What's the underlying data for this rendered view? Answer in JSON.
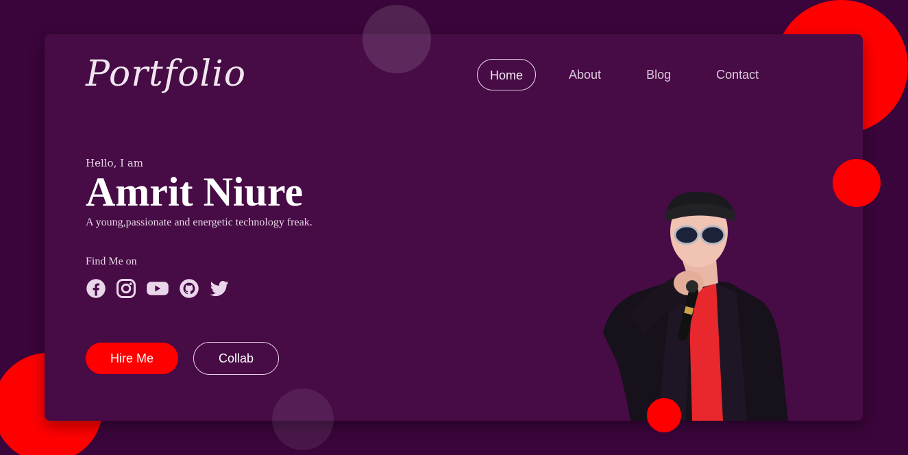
{
  "logo": {
    "text": "Portfolio"
  },
  "nav": {
    "items": [
      {
        "label": "Home",
        "active": true
      },
      {
        "label": "About",
        "active": false
      },
      {
        "label": "Blog",
        "active": false
      },
      {
        "label": "Contact",
        "active": false
      }
    ]
  },
  "hero": {
    "greeting": "Hello, I am",
    "name": "Amrit Niure",
    "tagline": "A young,passionate and energetic technology freak.",
    "find_label": "Find Me on",
    "socials": [
      {
        "icon": "facebook-icon"
      },
      {
        "icon": "instagram-icon"
      },
      {
        "icon": "youtube-icon"
      },
      {
        "icon": "github-icon"
      },
      {
        "icon": "twitter-icon"
      }
    ],
    "hire_label": "Hire Me",
    "collab_label": "Collab"
  },
  "colors": {
    "background": "#3a053a",
    "card": "#470b46",
    "accent": "#ff0000",
    "text": "#ffffff"
  }
}
